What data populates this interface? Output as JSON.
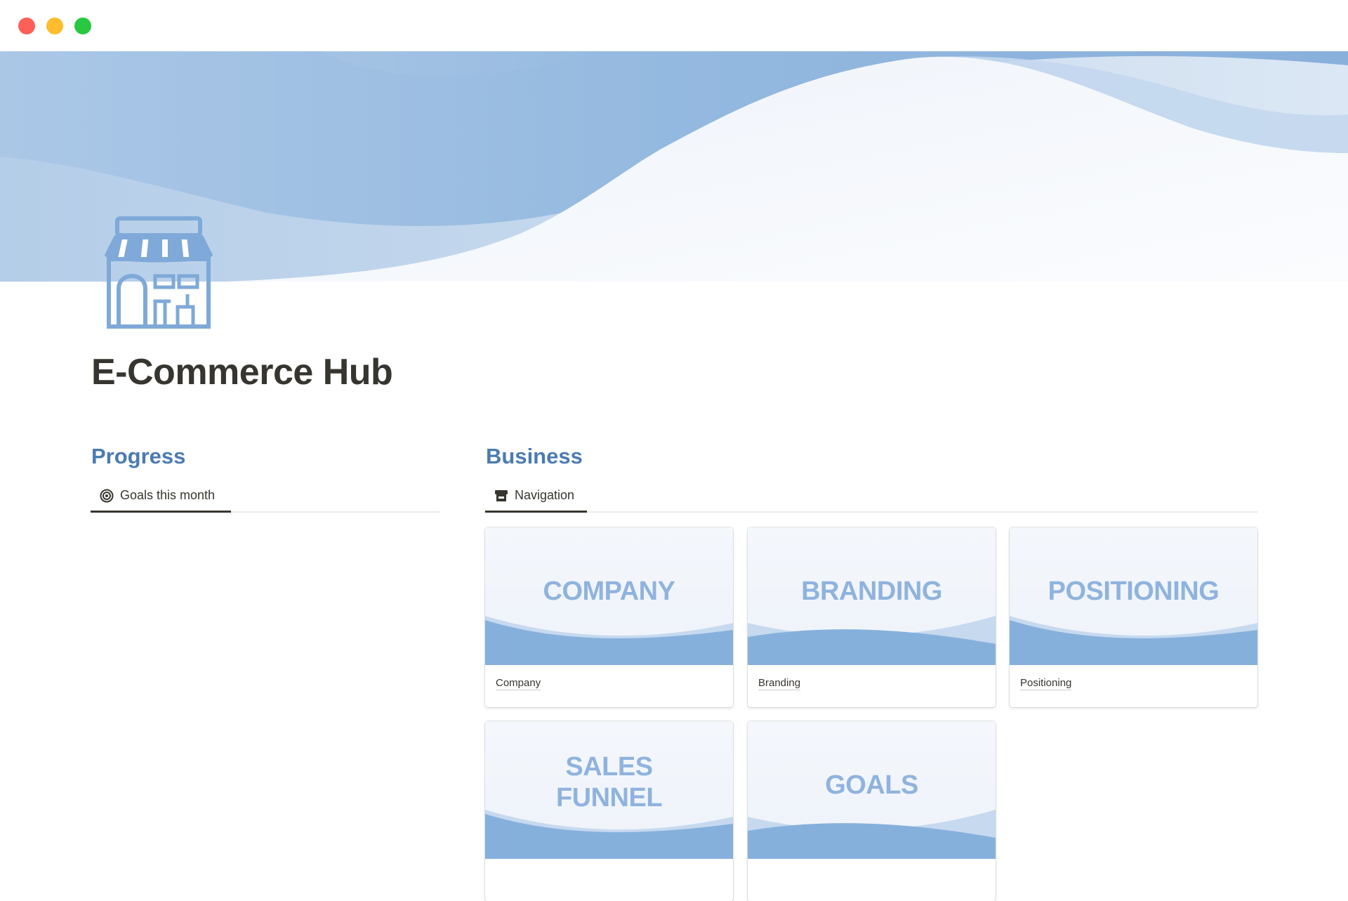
{
  "window": {
    "controls": [
      "close",
      "minimize",
      "zoom"
    ]
  },
  "page": {
    "title": "E-Commerce Hub",
    "icon": "storefront-icon",
    "cover_colors": [
      "#a9c6e6",
      "#7ea9d8",
      "#f5f8fc"
    ]
  },
  "progress": {
    "heading": "Progress",
    "tab": {
      "label": "Goals this month",
      "icon": "target-icon"
    }
  },
  "business": {
    "heading": "Business",
    "tab": {
      "label": "Navigation",
      "icon": "store-icon"
    },
    "cards": [
      {
        "cover_text": "COMPANY",
        "caption": "Company"
      },
      {
        "cover_text": "BRANDING",
        "caption": "Branding"
      },
      {
        "cover_text": "POSITIONING",
        "caption": "Positioning"
      },
      {
        "cover_text": "SALES\nFUNNEL",
        "caption": ""
      },
      {
        "cover_text": "GOALS",
        "caption": ""
      }
    ]
  },
  "colors": {
    "heading": "#4b7bb0",
    "card_text": "#8fb3de",
    "title": "#37352f"
  }
}
